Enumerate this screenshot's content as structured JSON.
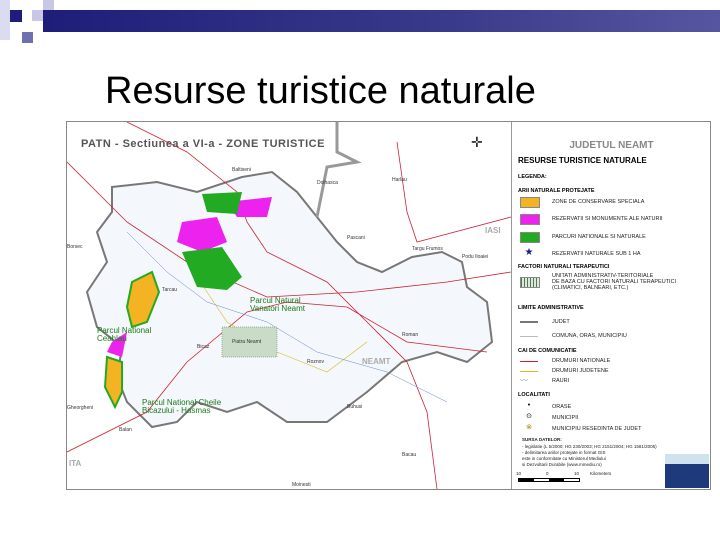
{
  "slide": {
    "title": "Resurse turistice naturale"
  },
  "map": {
    "title": "PATN - Sectiunea a VI-a - ZONE TURISTICE",
    "compass": "N",
    "places": [
      "Baltiseni",
      "Dolhasca",
      "Harlau",
      "Pascani",
      "Targu Frumos",
      "Podu Iloaiei",
      "Tarcau",
      "Piatra Neamt",
      "Bicaz",
      "Roznov",
      "Roman",
      "Buhusi",
      "Bacau",
      "Balan",
      "Borsec",
      "Gheorgheni",
      "Moinesti"
    ],
    "regions": [
      "IASI",
      "NEAMT",
      "ITA"
    ],
    "parks": [
      {
        "name": "Parcul Natural Vanatori Neamt"
      },
      {
        "name": "Parcul National Ceahlau"
      },
      {
        "name": "Parcul National Cheile Bicazului - Hasmas"
      }
    ],
    "legend": {
      "county": "JUDETUL NEAMT",
      "heading": "RESURSE TURISTICE NATURALE",
      "legend_label": "LEGENDA:",
      "sections": [
        {
          "title": "ARII NATURALE PROTEJATE",
          "items": [
            {
              "label": "ZONE DE CONSERVARE SPECIALA",
              "color": "#f4b322"
            },
            {
              "label": "REZERVATII SI MONUMENTE ALE NATURII",
              "color": "#ee22ee"
            },
            {
              "label": "PARCURI NATIONALE SI NATURALE",
              "color": "#22aa22"
            },
            {
              "label": "REZERVATII NATURALE SUB 1 HA",
              "icon": "star-icon"
            }
          ]
        },
        {
          "title": "FACTORI NATURALI TERAPEUTICI",
          "items": [
            {
              "label": "UNITATI ADMINISTRATIV-TERITORIALE",
              "label2": "DE BAZA CU FACTORI NATURALI TERAPEUTICI",
              "label3": "(CLIMATICI, BALNEARI, ETC.)"
            }
          ]
        },
        {
          "title": "LIMITE ADMINISTRATIVE",
          "items": [
            {
              "label": "JUDET"
            },
            {
              "label": "COMUNA, ORAS, MUNICIPIU"
            }
          ]
        },
        {
          "title": "CAI DE COMUNICATIE",
          "items": [
            {
              "label": "DRUMURI NATIONALE",
              "color": "#cc2233"
            },
            {
              "label": "DRUMURI JUDETENE",
              "color": "#ddbb22"
            },
            {
              "label": "RAURI"
            }
          ]
        },
        {
          "title": "LOCALITATI",
          "items": [
            {
              "label": "ORASE"
            },
            {
              "label": "MUNICIPII"
            },
            {
              "label": "MUNICIPIU RESEDINTA DE JUDET"
            }
          ]
        }
      ],
      "sources_title": "SURSA DATELOR:",
      "sources": [
        "- legislatie (L 5/2000; HG 230/2003; HG 2151/2004; HG 1581/2005)",
        "- delimitarea ariilor protejate in format GIS",
        "  este in conformitate cu Ministerul Mediului",
        "  si Dezvoltarii Durabile (www.mmediu.ro)"
      ],
      "scale": {
        "left": "10",
        "mid": "0",
        "right": "10",
        "unit": "Kilometers"
      }
    }
  }
}
